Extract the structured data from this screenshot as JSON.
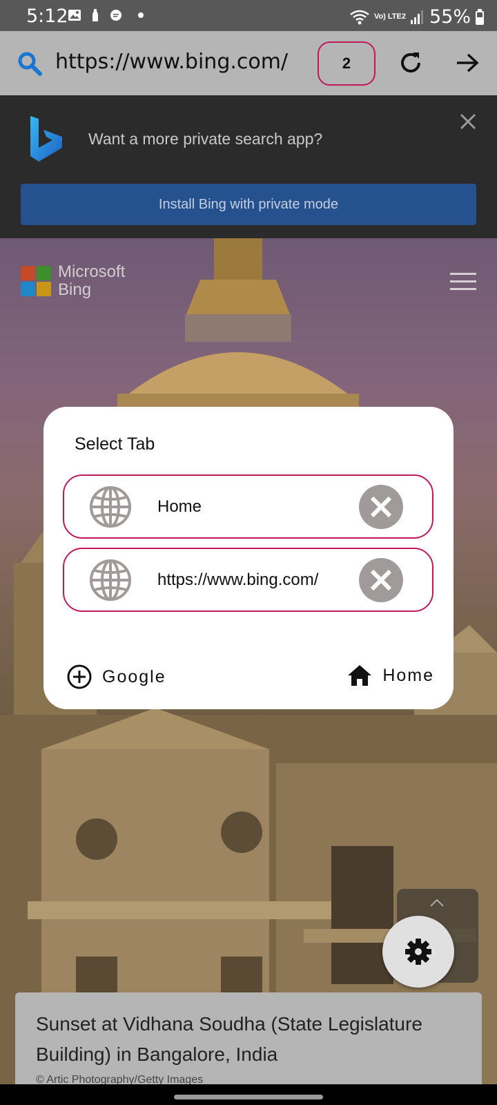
{
  "status_bar": {
    "time": "5:12",
    "network_label": "Vo) LTE2",
    "battery": "55%"
  },
  "url_bar": {
    "url": "https://www.bing.com/",
    "tab_count": "2"
  },
  "promo": {
    "text": "Want a more private search app?",
    "button_label": "Install Bing with private mode"
  },
  "header": {
    "brand_line1": "Microsoft",
    "brand_line2": "Bing"
  },
  "dialog": {
    "title": "Select Tab",
    "tabs": [
      {
        "label": "Home"
      },
      {
        "label": "https://www.bing.com/"
      }
    ],
    "add_label": "Google",
    "home_label": "Home"
  },
  "caption": {
    "title": "Sunset at Vidhana Soudha (State Legislature Building) in Bangalore, India",
    "credit": "© Artic Photography/Getty Images"
  },
  "colors": {
    "accent": "#c2185b",
    "promo_button": "#25518f",
    "icon_gray": "#a09a9a"
  }
}
